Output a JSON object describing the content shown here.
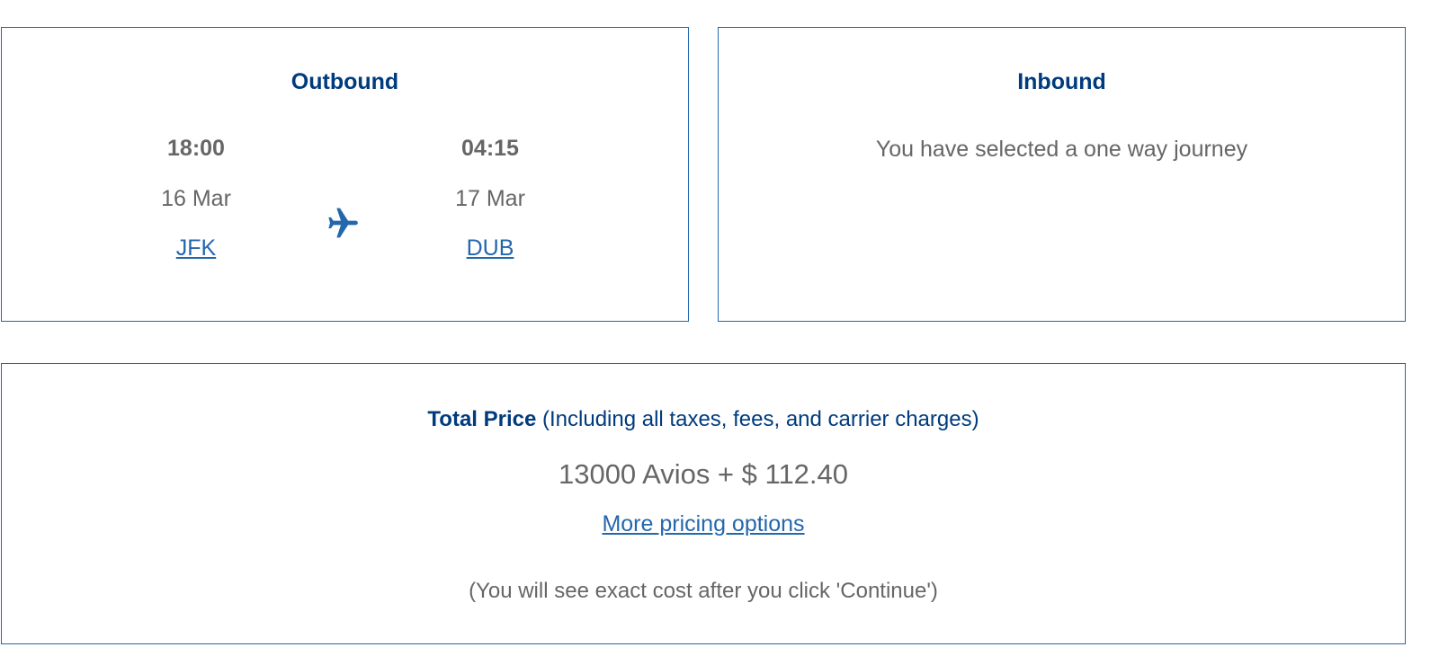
{
  "outbound": {
    "title": "Outbound",
    "departure": {
      "time": "18:00",
      "date": "16 Mar",
      "airport": "JFK"
    },
    "arrival": {
      "time": "04:15",
      "date": "17 Mar",
      "airport": "DUB"
    },
    "icon": "airplane-icon"
  },
  "inbound": {
    "title": "Inbound",
    "message": "You have selected a one way journey"
  },
  "price": {
    "label": "Total Price",
    "qualifier": "(Including all taxes, fees, and carrier charges)",
    "value": "13000 Avios + $ 112.40",
    "more_link": "More pricing options",
    "note": "(You will see exact cost after you click 'Continue')"
  },
  "colors": {
    "accent": "#2467ad",
    "heading": "#003b7e",
    "text": "#666666"
  }
}
